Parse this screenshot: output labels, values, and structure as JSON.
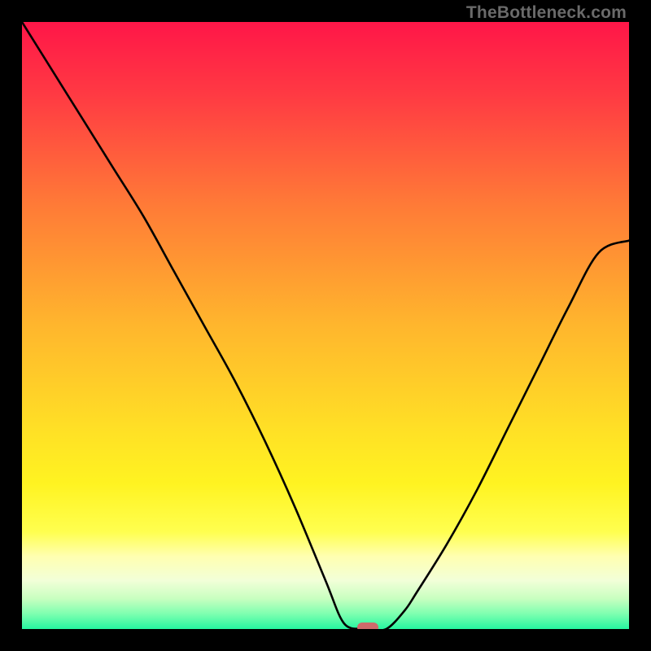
{
  "watermark": "TheBottleneck.com",
  "chart_data": {
    "type": "line",
    "title": "",
    "xlabel": "",
    "ylabel": "",
    "xlim": [
      0,
      100
    ],
    "ylim": [
      0,
      100
    ],
    "grid": false,
    "background_gradient": {
      "stops": [
        {
          "offset": 0.0,
          "color": "#ff1648"
        },
        {
          "offset": 0.12,
          "color": "#ff3a43"
        },
        {
          "offset": 0.3,
          "color": "#ff7a37"
        },
        {
          "offset": 0.5,
          "color": "#ffb62d"
        },
        {
          "offset": 0.68,
          "color": "#ffe225"
        },
        {
          "offset": 0.76,
          "color": "#fff321"
        },
        {
          "offset": 0.84,
          "color": "#ffff4f"
        },
        {
          "offset": 0.88,
          "color": "#ffffb0"
        },
        {
          "offset": 0.92,
          "color": "#f2ffd8"
        },
        {
          "offset": 0.95,
          "color": "#c8ffc0"
        },
        {
          "offset": 0.975,
          "color": "#7effb0"
        },
        {
          "offset": 1.0,
          "color": "#26f6a0"
        }
      ]
    },
    "series": [
      {
        "name": "bottleneck-curve",
        "color": "#000000",
        "x": [
          0,
          5,
          10,
          15,
          20,
          25,
          30,
          35,
          40,
          45,
          50,
          53,
          56,
          57,
          60,
          63,
          65,
          70,
          75,
          80,
          85,
          90,
          95,
          100
        ],
        "y": [
          100,
          92,
          84,
          76,
          68,
          59,
          50,
          41,
          31,
          20,
          8,
          1,
          0,
          0,
          0,
          3,
          6,
          14,
          23,
          33,
          43,
          53,
          62,
          64
        ]
      }
    ],
    "marker": {
      "x": 57,
      "y": 0,
      "color": "#cf6a6b"
    }
  }
}
